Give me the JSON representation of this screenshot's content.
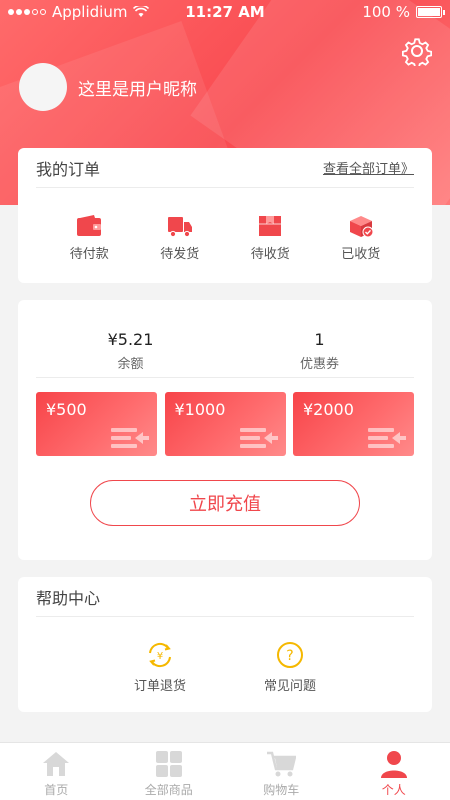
{
  "status_bar": {
    "carrier": "Applidium",
    "time": "11:27 AM",
    "battery": "100 %"
  },
  "profile": {
    "nickname": "这里是用户昵称",
    "settings_icon": "gear-icon"
  },
  "orders": {
    "title": "我的订单",
    "view_all": "查看全部订单》",
    "items": [
      {
        "label": "待付款",
        "icon": "wallet-icon"
      },
      {
        "label": "待发货",
        "icon": "truck-icon"
      },
      {
        "label": "待收货",
        "icon": "box-icon"
      },
      {
        "label": "已收货",
        "icon": "package-check-icon"
      }
    ]
  },
  "wallet": {
    "balance_value": "¥5.21",
    "balance_label": "余额",
    "coupon_value": "1",
    "coupon_label": "优惠券",
    "recharge_options": [
      {
        "amount": "¥500"
      },
      {
        "amount": "¥1000"
      },
      {
        "amount": "¥2000"
      }
    ],
    "recharge_button": "立即充值"
  },
  "help": {
    "title": "帮助中心",
    "items": [
      {
        "label": "订单退货",
        "icon": "refund-icon"
      },
      {
        "label": "常见问题",
        "icon": "question-icon"
      }
    ]
  },
  "tabbar": {
    "items": [
      {
        "label": "首页",
        "icon": "home-icon",
        "active": false
      },
      {
        "label": "全部商品",
        "icon": "grid-icon",
        "active": false
      },
      {
        "label": "购物车",
        "icon": "cart-icon",
        "active": false
      },
      {
        "label": "个人",
        "icon": "user-icon",
        "active": true
      }
    ]
  },
  "colors": {
    "accent": "#f0474c",
    "header_start": "#ff6b6b",
    "help_icon": "#f5b800"
  }
}
